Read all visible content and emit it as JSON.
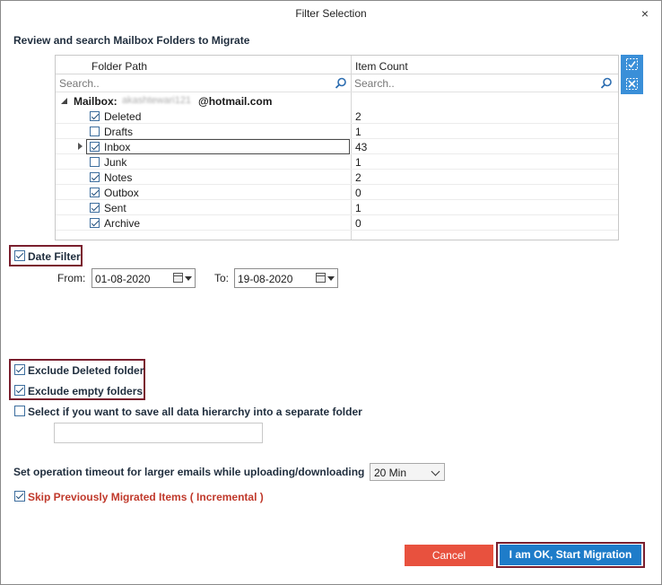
{
  "window": {
    "title": "Filter Selection",
    "close_glyph": "×"
  },
  "heading": "Review and search Mailbox Folders to Migrate",
  "grid": {
    "col_folder": "Folder Path",
    "col_count": "Item Count",
    "search_placeholder_folder": "Search..",
    "search_placeholder_count": "Search..",
    "mailbox_label": "Mailbox:",
    "mailbox_masked": "akashtewari121",
    "mailbox_domain": "@hotmail.com",
    "rows": [
      {
        "name": "Deleted",
        "count": "2",
        "checked": true
      },
      {
        "name": "Drafts",
        "count": "1",
        "checked": false
      },
      {
        "name": "Inbox",
        "count": "43",
        "checked": true,
        "selected": true
      },
      {
        "name": "Junk",
        "count": "1",
        "checked": false
      },
      {
        "name": "Notes",
        "count": "2",
        "checked": true
      },
      {
        "name": "Outbox",
        "count": "0",
        "checked": true
      },
      {
        "name": "Sent",
        "count": "1",
        "checked": true
      },
      {
        "name": "Archive",
        "count": "0",
        "checked": true
      }
    ]
  },
  "side_buttons": {
    "check_all_icon": "check-all-icon",
    "uncheck_all_icon": "uncheck-all-icon"
  },
  "date_filter": {
    "label": "Date Filter",
    "checked": true,
    "from_label": "From:",
    "from_value": "01-08-2020",
    "to_label": "To:",
    "to_value": "19-08-2020"
  },
  "options": {
    "exclude_deleted": "Exclude Deleted folder",
    "exclude_empty": "Exclude empty folders",
    "save_hierarchy": "Select if you want to save all data hierarchy into a separate folder",
    "hierarchy_folder_value": ""
  },
  "timeout": {
    "label": "Set operation timeout for larger emails while uploading/downloading",
    "value": "20 Min"
  },
  "skip": {
    "label": "Skip Previously Migrated Items ( Incremental )",
    "checked": true
  },
  "buttons": {
    "cancel": "Cancel",
    "start": "I am OK, Start Migration"
  },
  "colors": {
    "accent": "#1e7cc9",
    "cancel": "#e8513e",
    "highlight": "#7a1f2e",
    "skip_text": "#c0392b"
  }
}
